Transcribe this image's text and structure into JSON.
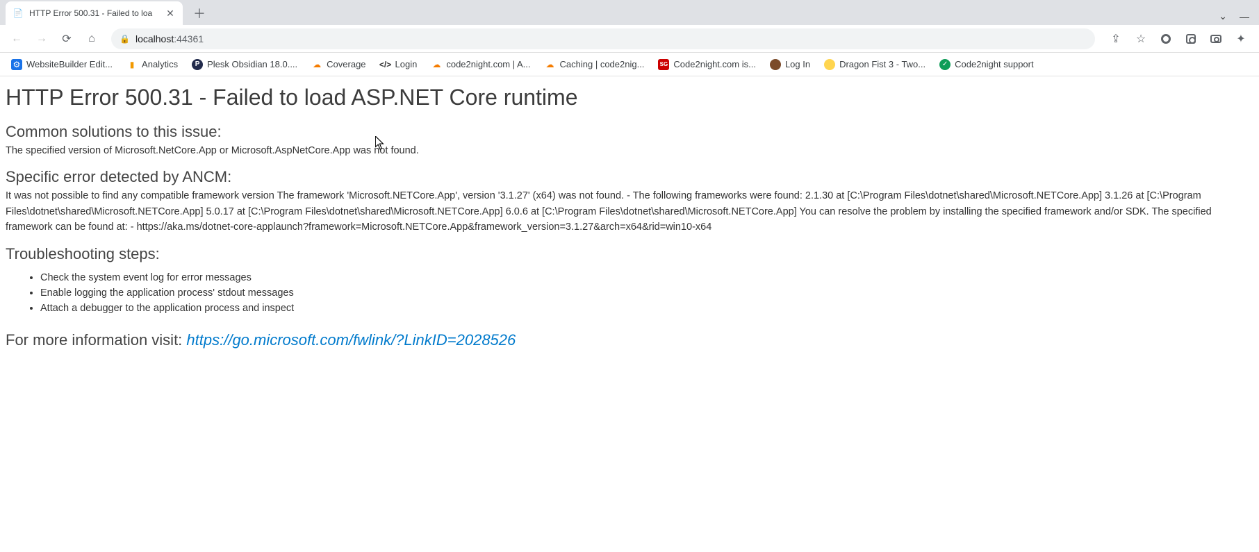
{
  "tab": {
    "title": "HTTP Error 500.31 - Failed to loa"
  },
  "address": {
    "host": "localhost",
    "port": ":44361"
  },
  "bookmarks": [
    {
      "label": "WebsiteBuilder Edit...",
      "icon": "ic-blue",
      "glyph": "⚙"
    },
    {
      "label": "Analytics",
      "icon": "ic-orange",
      "glyph": "▮"
    },
    {
      "label": "Plesk Obsidian 18.0....",
      "icon": "ic-darkblue",
      "glyph": "P"
    },
    {
      "label": "Coverage",
      "icon": "ic-cloud",
      "glyph": "☁"
    },
    {
      "label": "Login",
      "icon": "ic-code",
      "glyph": "</>"
    },
    {
      "label": "code2night.com | A...",
      "icon": "ic-cloud",
      "glyph": "☁"
    },
    {
      "label": "Caching | code2nig...",
      "icon": "ic-cloud",
      "glyph": "☁"
    },
    {
      "label": "Code2night.com is...",
      "icon": "ic-red",
      "glyph": "SG"
    },
    {
      "label": "Log In",
      "icon": "ic-brown",
      "glyph": ""
    },
    {
      "label": "Dragon Fist 3 - Two...",
      "icon": "ic-yellow",
      "glyph": ""
    },
    {
      "label": "Code2night support",
      "icon": "ic-green",
      "glyph": "✓"
    }
  ],
  "page": {
    "h1": "HTTP Error 500.31 - Failed to load ASP.NET Core runtime",
    "solutions_heading": "Common solutions to this issue:",
    "solutions_body": "The specified version of Microsoft.NetCore.App or Microsoft.AspNetCore.App was not found.",
    "ancm_heading": "Specific error detected by ANCM:",
    "ancm_body": "It was not possible to find any compatible framework version The framework 'Microsoft.NETCore.App', version '3.1.27' (x64) was not found. - The following frameworks were found: 2.1.30 at [C:\\Program Files\\dotnet\\shared\\Microsoft.NETCore.App] 3.1.26 at [C:\\Program Files\\dotnet\\shared\\Microsoft.NETCore.App] 5.0.17 at [C:\\Program Files\\dotnet\\shared\\Microsoft.NETCore.App] 6.0.6 at [C:\\Program Files\\dotnet\\shared\\Microsoft.NETCore.App] You can resolve the problem by installing the specified framework and/or SDK. The specified framework can be found at: - https://aka.ms/dotnet-core-applaunch?framework=Microsoft.NETCore.App&framework_version=3.1.27&arch=x64&rid=win10-x64",
    "ts_heading": "Troubleshooting steps:",
    "ts_steps": [
      "Check the system event log for error messages",
      "Enable logging the application process' stdout messages",
      "Attach a debugger to the application process and inspect"
    ],
    "info_prefix": "For more information visit: ",
    "info_link": "https://go.microsoft.com/fwlink/?LinkID=2028526"
  }
}
